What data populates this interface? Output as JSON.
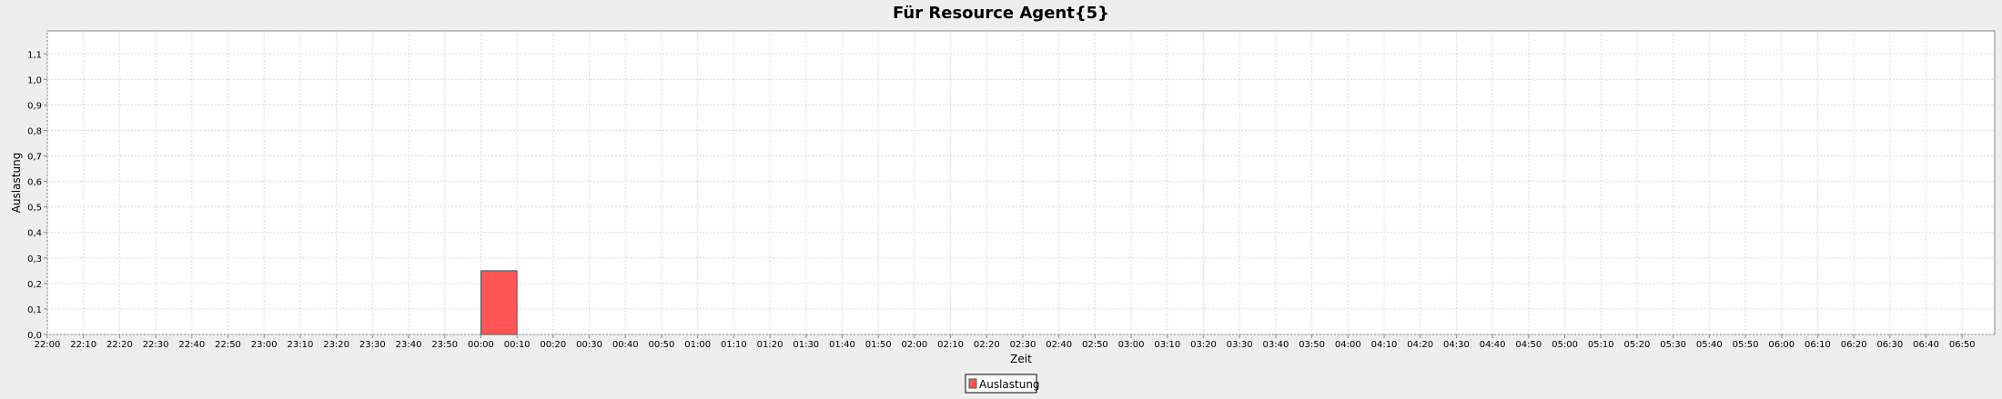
{
  "chart_data": {
    "type": "bar",
    "title": "Für Resource Agent{5}",
    "xlabel": "Zeit",
    "ylabel": "Auslastung",
    "x_ticks": [
      "22:00",
      "22:10",
      "22:20",
      "22:30",
      "22:40",
      "22:50",
      "23:00",
      "23:10",
      "23:20",
      "23:30",
      "23:40",
      "23:50",
      "00:00",
      "00:10",
      "00:20",
      "00:30",
      "00:40",
      "00:50",
      "01:00",
      "01:10",
      "01:20",
      "01:30",
      "01:40",
      "01:50",
      "02:00",
      "02:10",
      "02:20",
      "02:30",
      "02:40",
      "02:50",
      "03:00",
      "03:10",
      "03:20",
      "03:30",
      "03:40",
      "03:50",
      "04:00",
      "04:10",
      "04:20",
      "04:30",
      "04:40",
      "04:50",
      "05:00",
      "05:10",
      "05:20",
      "05:30",
      "05:40",
      "05:50",
      "06:00",
      "06:10",
      "06:20",
      "06:30",
      "06:40",
      "06:50"
    ],
    "y_ticks": [
      "0,0",
      "0,1",
      "0,2",
      "0,3",
      "0,4",
      "0,5",
      "0,6",
      "0,7",
      "0,8",
      "0,9",
      "1,0",
      "1,1"
    ],
    "xlim": [
      "22:00",
      "06:59"
    ],
    "ylim": [
      0,
      1.19
    ],
    "grid": true,
    "legend_position": "bottom-center",
    "series": [
      {
        "name": "Auslastung",
        "color": "#ff5555",
        "bars": [
          {
            "start": "00:00",
            "end": "00:10",
            "value": 0.25
          }
        ]
      }
    ]
  }
}
